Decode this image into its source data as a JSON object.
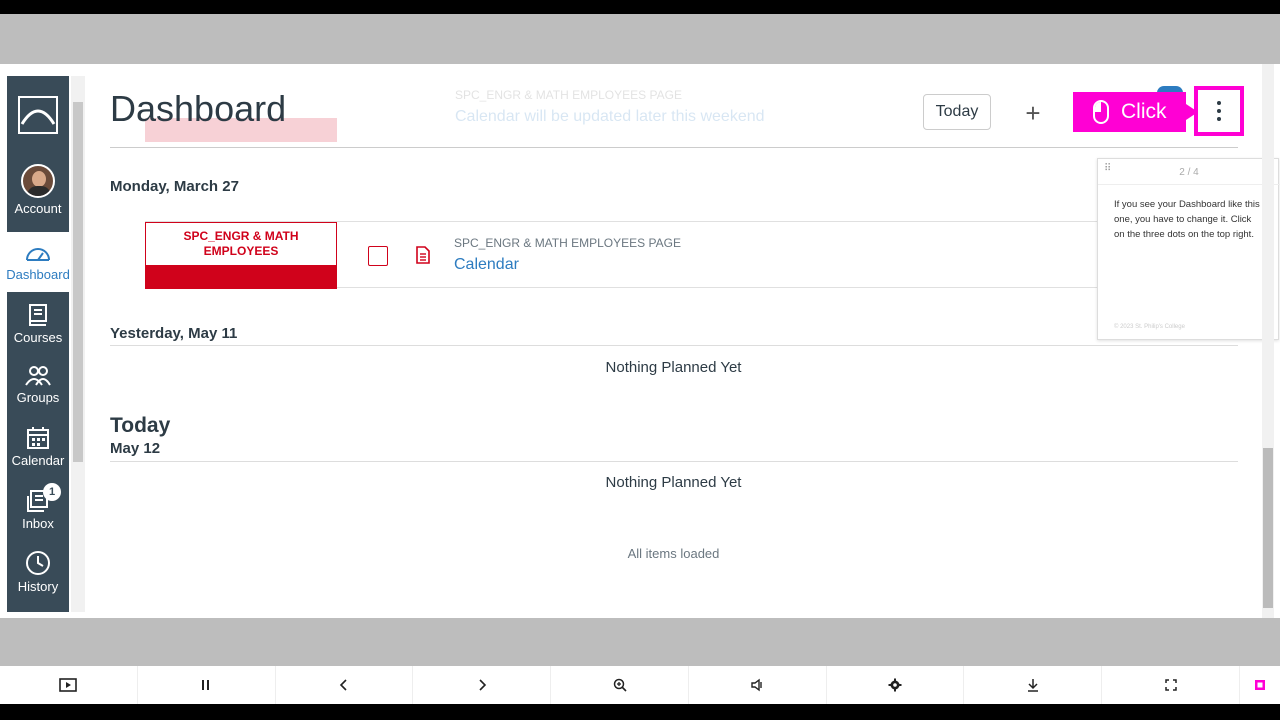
{
  "page": {
    "title": "Dashboard",
    "today_button": "Today",
    "add_button": "+"
  },
  "sidebar": {
    "items": [
      {
        "label": "Account"
      },
      {
        "label": "Dashboard"
      },
      {
        "label": "Courses"
      },
      {
        "label": "Groups"
      },
      {
        "label": "Calendar"
      },
      {
        "label": "Inbox",
        "badge": "1"
      },
      {
        "label": "History"
      }
    ]
  },
  "faded_header": {
    "course": "SPC_ENGR & MATH EMPLOYEES PAGE",
    "text": "Calendar will be updated later this weekend"
  },
  "annotation": {
    "click_label": "Click"
  },
  "planner": {
    "day1": {
      "date": "Monday, March 27",
      "item": {
        "course_name": "SPC_ENGR & MATH EMPLOYEES",
        "course_label": "SPC_ENGR & MATH EMPLOYEES PAGE",
        "title": "Calendar"
      }
    },
    "day2": {
      "date": "Yesterday, May 11",
      "empty": "Nothing Planned Yet"
    },
    "day3": {
      "heading": "Today",
      "date": "May 12",
      "empty": "Nothing Planned Yet"
    },
    "footer": "All items loaded"
  },
  "tooltip": {
    "count": "2 / 4",
    "text": "If you see your Dashboard like this one, you have to change it. Click on the three dots on the top right.",
    "footer": "© 2023 St. Philip's College"
  },
  "controls": [
    {
      "icon": "slideshow-icon"
    },
    {
      "icon": "pause-icon"
    },
    {
      "icon": "previous-icon"
    },
    {
      "icon": "next-icon"
    },
    {
      "icon": "zoom-icon"
    },
    {
      "icon": "volume-icon"
    },
    {
      "icon": "settings-icon"
    },
    {
      "icon": "download-icon"
    },
    {
      "icon": "fullscreen-icon"
    },
    {
      "icon": "stop-icon"
    }
  ],
  "colors": {
    "sidebar": "#394b58",
    "link": "#2d7cc0",
    "course": "#d0021b",
    "highlight": "#ff00d4"
  }
}
